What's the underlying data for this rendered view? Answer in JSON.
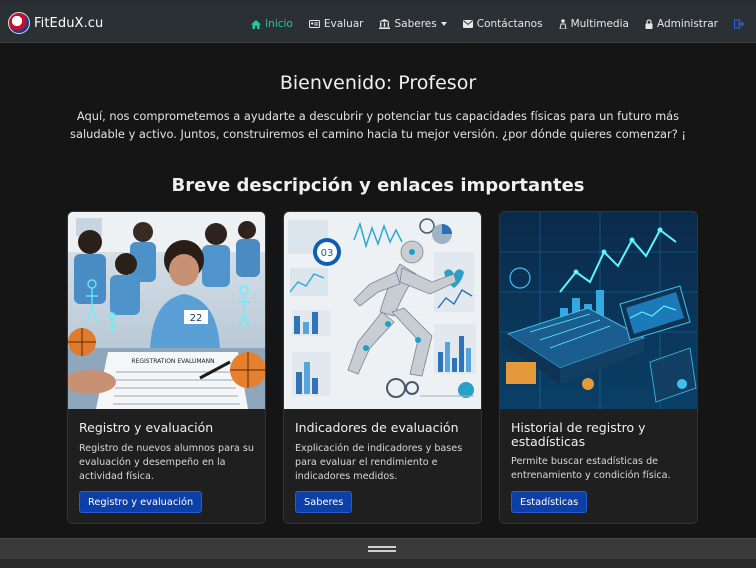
{
  "brand": {
    "name": "FitEduX.cu"
  },
  "nav": {
    "items": [
      {
        "label": "Inicio",
        "icon": "home-icon",
        "active": true
      },
      {
        "label": "Evaluar",
        "icon": "id-card-icon"
      },
      {
        "label": "Saberes",
        "icon": "bank-icon",
        "dropdown": true
      },
      {
        "label": "Contáctanos",
        "icon": "envelope-icon"
      },
      {
        "label": "Multimedia",
        "icon": "person-icon"
      },
      {
        "label": "Administrar",
        "icon": "lock-icon"
      },
      {
        "label": "",
        "icon": "logout-icon"
      }
    ]
  },
  "hero": {
    "title": "Bienvenido: Profesor",
    "lead": "Aquí, nos comprometemos a ayudarte a descubrir y potenciar tus capacidades físicas para un futuro más saludable y activo. Juntos, construiremos el camino hacia tu mejor versión. ¿por dónde quieres comenzar? ¡"
  },
  "section": {
    "title": "Breve descripción y enlaces importantes"
  },
  "cards": [
    {
      "title": "Registro y evaluación",
      "text": "Registro de nuevos alumnos para su evaluación y desempeño en la actividad física.",
      "button": "Registro y evaluación",
      "image_labels": {
        "shirt": "22",
        "sheet": "REGISTRATION EVALUMANN"
      }
    },
    {
      "title": "Indicadores de evaluación",
      "text": "Explicación de indicadores y bases para evaluar el rendimiento e indicadores medidos.",
      "button": "Saberes",
      "image_labels": {
        "dial": "03"
      }
    },
    {
      "title": "Historial de registro y estadísticas",
      "text": "Permite buscar estadísticas de entrenamiento y condición física.",
      "button": "Estadísticas"
    }
  ],
  "colors": {
    "navbar": "#2b3035",
    "active": "#20c997",
    "button": "#0d3fa8",
    "background": "#151515",
    "card": "#1f1f1f"
  }
}
